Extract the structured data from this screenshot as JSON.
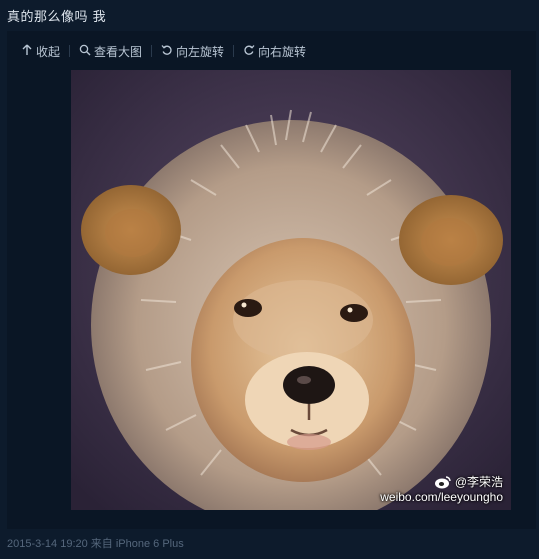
{
  "post": {
    "text": "真的那么像吗 我"
  },
  "toolbar": {
    "collapse_label": "收起",
    "view_large_label": "查看大图",
    "rotate_left_label": "向左旋转",
    "rotate_right_label": "向右旋转"
  },
  "image": {
    "subject": "puppy wearing lion mane costume",
    "watermark_user": "@李荣浩",
    "watermark_url": "weibo.com/leeyoungho"
  },
  "footer": {
    "meta": "2015-3-14 19:20 来自 iPhone 6 Plus"
  },
  "icons": [
    "collapse-arrow-icon",
    "magnifier-icon",
    "rotate-left-icon",
    "rotate-right-icon",
    "weibo-logo-icon"
  ]
}
